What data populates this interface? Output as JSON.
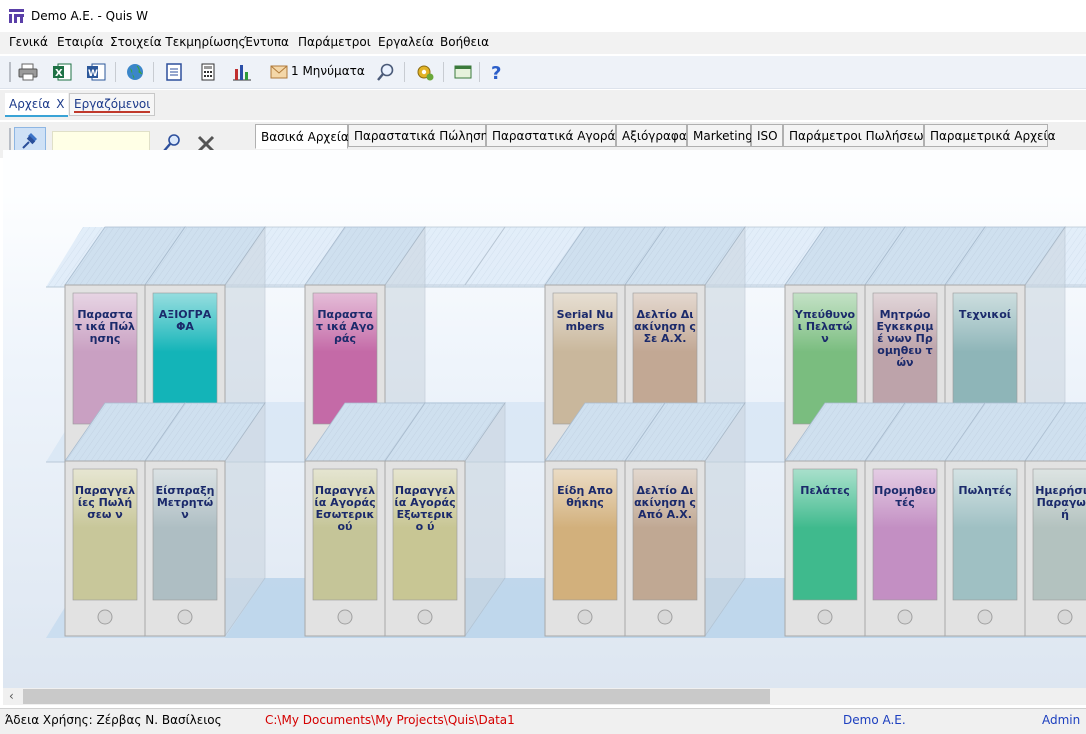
{
  "window": {
    "title": "Demo A.E. - Quis W"
  },
  "menu": [
    "Γενικά",
    "Εταιρία",
    "Στοιχεία Τεκμηρίωσης",
    "Έντυπα",
    "Παράμετροι",
    "Εργαλεία",
    "Βοήθεια"
  ],
  "toolbar": {
    "messages_label": "1 Μηνύματα",
    "icons": [
      "print-icon",
      "excel-icon",
      "word-icon",
      "globe-icon",
      "notes-icon",
      "calculator-icon",
      "bar-chart-icon",
      "mail-icon",
      "search-icon",
      "settings-icon",
      "window-icon",
      "help-icon"
    ]
  },
  "workspace_tabs": [
    {
      "label": "Αρχεία",
      "close": "X"
    },
    {
      "label": "Εργαζόμενοι"
    }
  ],
  "search": {
    "value": ""
  },
  "file_tabs": [
    "Βασικά Αρχεία",
    "Παραστατικά Πώλησης",
    "Παραστατικά Αγοράς",
    "Αξιόγραφα",
    "Marketing",
    "ISO",
    "Παράμετροι Πωλήσεων",
    "Παραμετρικά Αρχεία"
  ],
  "binders_top": [
    {
      "label": "Παραστατ ικά Πώλησης",
      "color": "#c9a0c2"
    },
    {
      "label": "ΑΞΙΟΓΡΑ ΦΑ",
      "color": "#13b4b8"
    },
    {
      "label": "Παραστατ ικά Αγοράς",
      "color": "#c46aa7"
    },
    {
      "label": "Serial Numbers",
      "color": "#c9b79c"
    },
    {
      "label": "Δελτίο Διακίνηση ς Σε Α.Χ.",
      "color": "#c2a894"
    },
    {
      "label": "Υπεύθυνο ι Πελατών",
      "color": "#7abd7f"
    },
    {
      "label": "Μητρώο Εγκεκριμέ νων Προμηθευ τών",
      "color": "#bda3aa"
    },
    {
      "label": "Τεχνικοί",
      "color": "#8eb5b8"
    }
  ],
  "binders_bottom": [
    {
      "label": "Παραγγελ ίες Πωλήσεω ν",
      "color": "#c8c79a"
    },
    {
      "label": "Είσπραξη Μετρητών",
      "color": "#aebec3"
    },
    {
      "label": "Παραγγελ ία Αγοράς Εσωτερικ ού",
      "color": "#c5c598"
    },
    {
      "label": "Παραγγελ ία Αγοράς Εξωτερικο ύ",
      "color": "#c8c694"
    },
    {
      "label": "Είδη Αποθήκης",
      "color": "#d2b07c"
    },
    {
      "label": "Δελτίο Διακίνηση ς Από Α.Χ.",
      "color": "#c0a893"
    },
    {
      "label": "Πελάτες",
      "color": "#3fba8d"
    },
    {
      "label": "Προμηθευ τές",
      "color": "#c38fc3"
    },
    {
      "label": "Πωλητές",
      "color": "#9fc0c3"
    },
    {
      "label": "Ημερήσια Παραγωγ ή",
      "color": "#b3c2bf"
    }
  ],
  "status": {
    "license": "Άδεια Χρήσης: Ζέρβας Ν. Βασίλειος",
    "path": "C:\\My Documents\\My Projects\\Quis\\Data1",
    "company": "Demo A.E.",
    "user": "Admin",
    "path_color": "#d40000",
    "link_color": "#1c3fbf"
  }
}
